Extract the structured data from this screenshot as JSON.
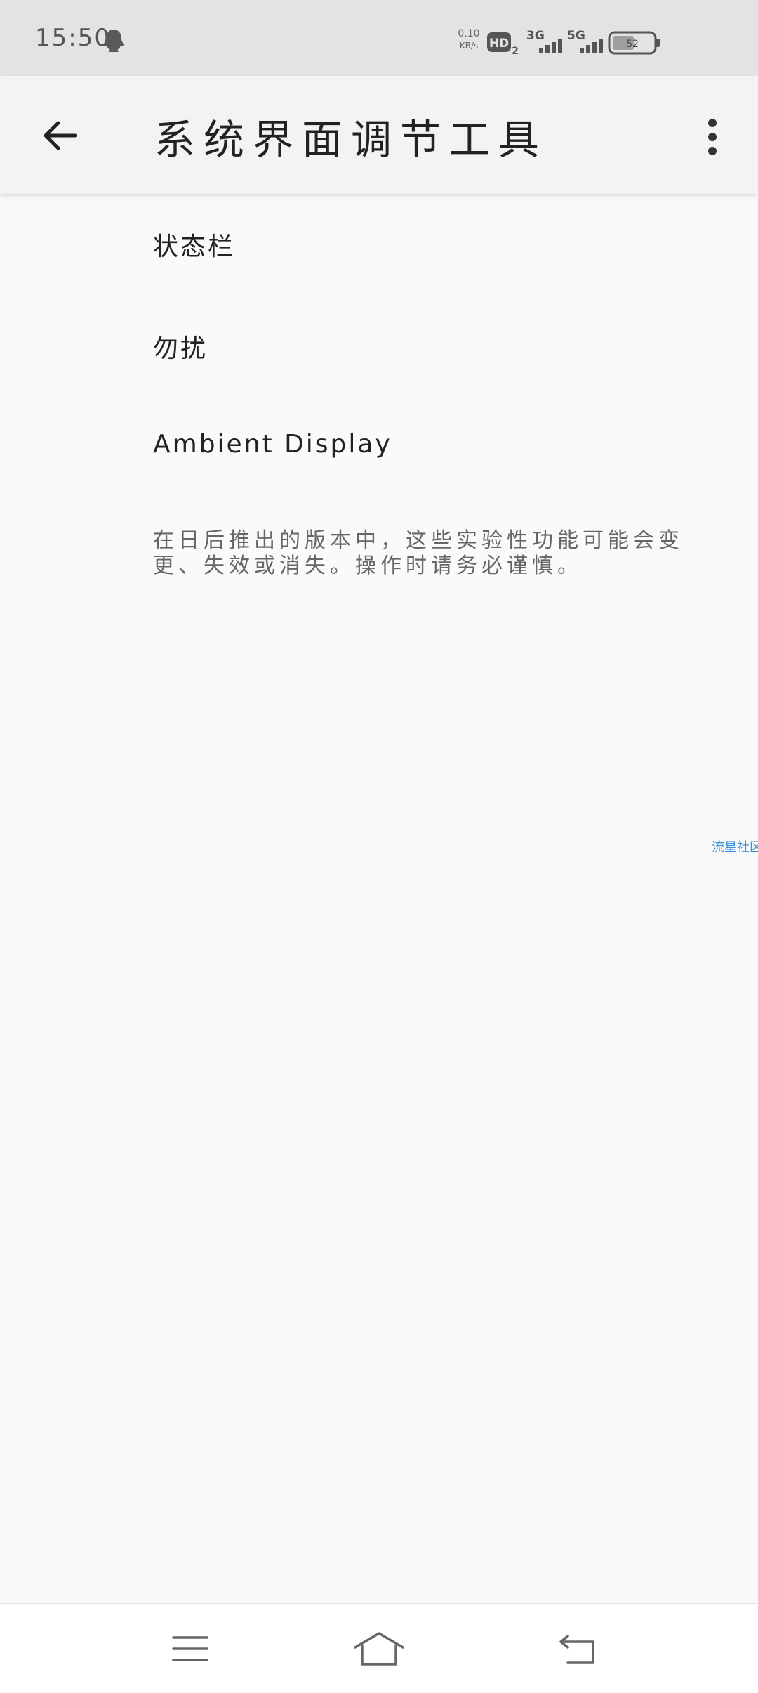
{
  "status_bar": {
    "time": "15:50",
    "net_speed_value": "0.10",
    "net_speed_unit": "KB/s",
    "battery_level": "52",
    "signal_1_label": "3G",
    "signal_2_label": "5G",
    "icons": [
      "qq-icon",
      "hd-voice-icon",
      "signal-3g-icon",
      "signal-5g-icon",
      "battery-icon"
    ]
  },
  "app_bar": {
    "title": "系统界面调节工具",
    "back_icon": "arrow-back-icon",
    "more_icon": "more-vert-icon"
  },
  "list": {
    "items": [
      {
        "label": "状态栏"
      },
      {
        "label": "勿扰"
      },
      {
        "label": "Ambient Display"
      }
    ],
    "disclaimer": "在日后推出的版本中，这些实验性功能可能会变更、失效或消失。操作时请务必谨慎。"
  },
  "watermark": "流星社区",
  "nav_bar": {
    "icons": [
      "menu-icon",
      "home-icon",
      "back-icon"
    ]
  },
  "colors": {
    "status_bar_bg": "#e3e3e3",
    "app_bar_bg": "#f3f3f3",
    "page_bg": "#fafafa",
    "watermark": "#3b8fd8"
  }
}
